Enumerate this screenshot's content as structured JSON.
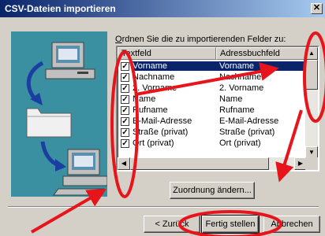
{
  "window": {
    "title": "CSV-Dateien importieren"
  },
  "prompt": {
    "accel": "O",
    "text": "rdnen Sie die zu importierenden Felder zu:"
  },
  "columns": {
    "field": "Textfeld",
    "addressbook": "Adressbuchfeld"
  },
  "rows": [
    {
      "field": "Vorname",
      "mapped": "Vorname",
      "checked": true,
      "selected": true
    },
    {
      "field": "Nachname",
      "mapped": "Nachname",
      "checked": true
    },
    {
      "field": "2. Vorname",
      "mapped": "2. Vorname",
      "checked": true
    },
    {
      "field": "Name",
      "mapped": "Name",
      "checked": true
    },
    {
      "field": "Rufname",
      "mapped": "Rufname",
      "checked": true
    },
    {
      "field": "E-Mail-Adresse",
      "mapped": "E-Mail-Adresse",
      "checked": true
    },
    {
      "field": "Straße (privat)",
      "mapped": "Straße (privat)",
      "checked": true
    },
    {
      "field": "Ort (privat)",
      "mapped": "Ort (privat)",
      "checked": true
    }
  ],
  "buttons": {
    "change_mapping": "Zuordnung ändern...",
    "back": "< Zurück",
    "finish": "Fertig stellen",
    "cancel": "Abbrechen"
  },
  "colors": {
    "annotation": "#e8141b",
    "selection": "#0a246a",
    "art_bg": "#3a8fa0"
  }
}
